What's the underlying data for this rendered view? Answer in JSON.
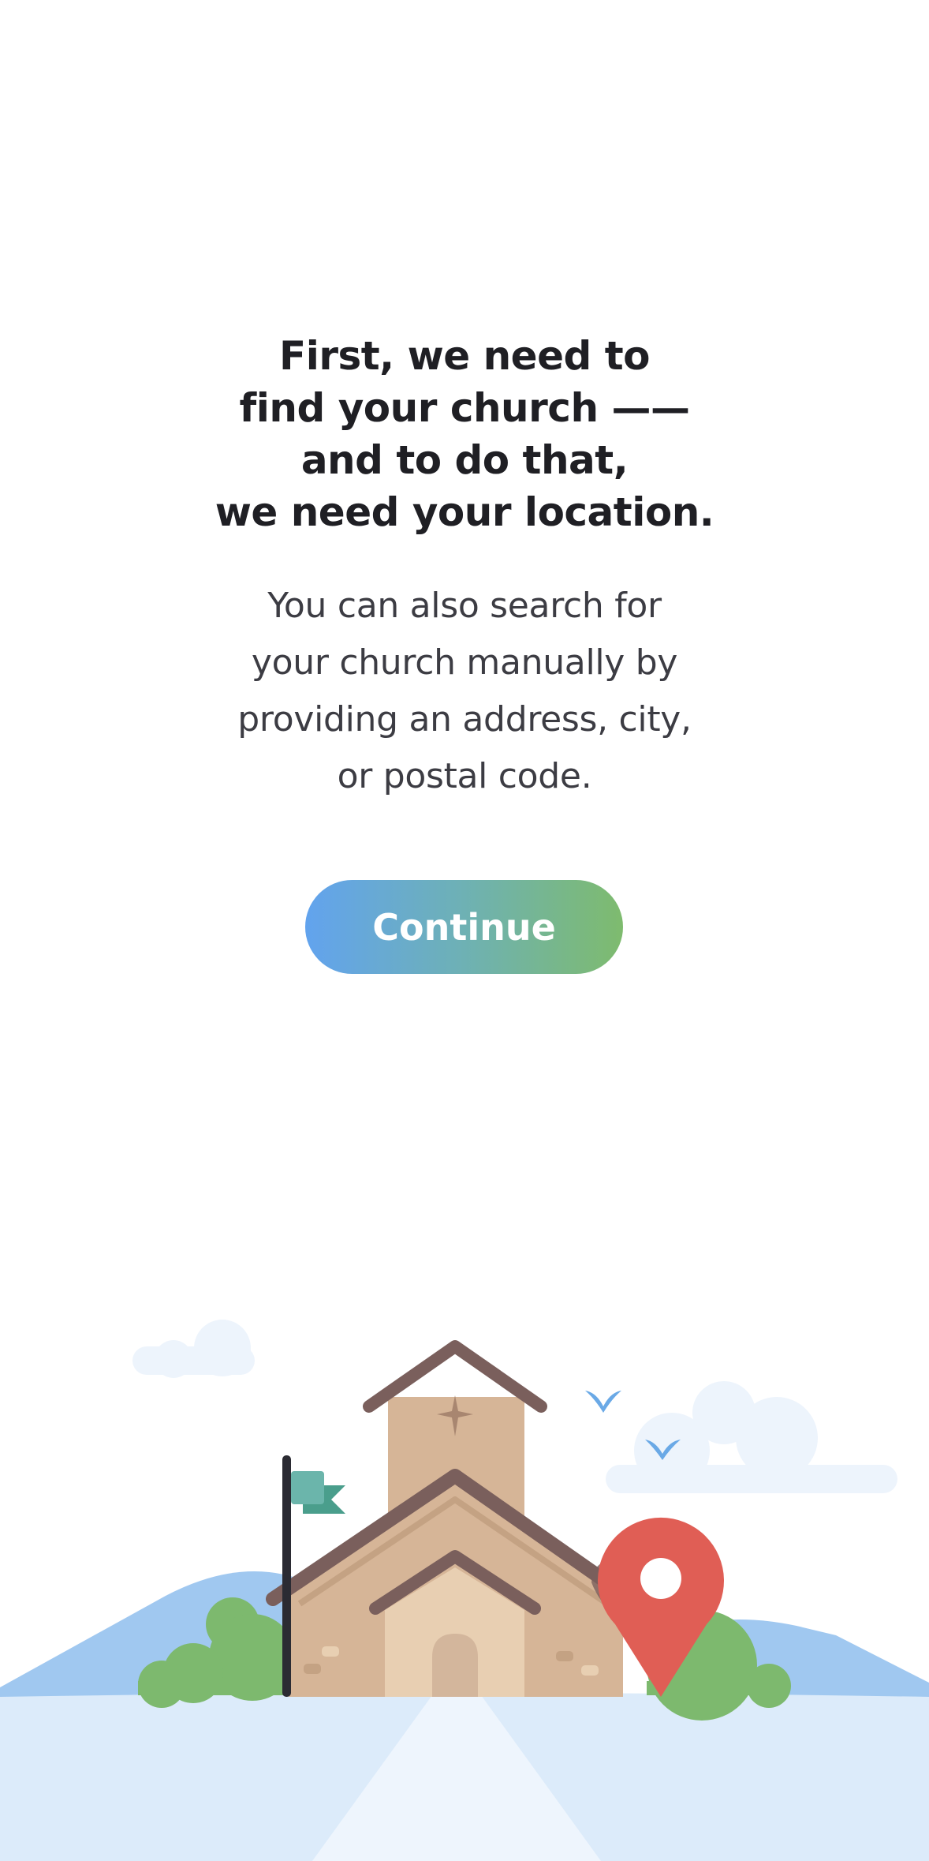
{
  "headline": {
    "lines": [
      "First, we need to",
      "find your church ——",
      "and to do that,",
      "we need your location."
    ]
  },
  "subtext": {
    "lines": [
      "You can also search for",
      "your church manually by",
      "providing an address, city,",
      "or postal code."
    ]
  },
  "continue_button": {
    "label": "Continue"
  },
  "illustration": {
    "icons": [
      "church-icon",
      "flag-icon",
      "location-pin-icon",
      "cloud-icon",
      "bird-icon"
    ]
  },
  "colors": {
    "button_gradient_start": "#62a3ee",
    "button_gradient_end": "#7ebb6e",
    "pin": "#e05e55",
    "ground": "#dcebfa",
    "hills": "#a0c8f0",
    "bushes": "#7db96e",
    "church_wall": "#d6b597",
    "church_roof": "#7a5f5c"
  }
}
